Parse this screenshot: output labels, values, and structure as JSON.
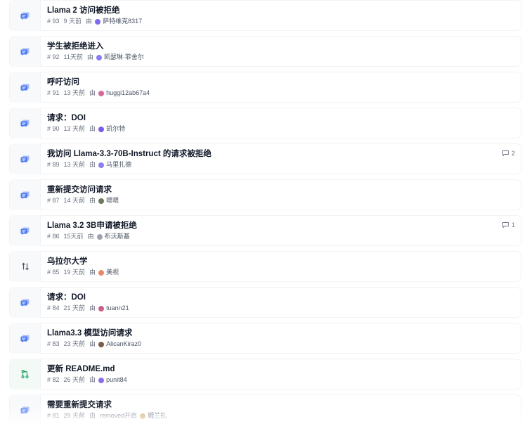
{
  "discussions": [
    {
      "title": "Llama 2 访问被拒绝",
      "number": "# 93",
      "age": "9 天前",
      "by": "由",
      "author": "萨特维克8317",
      "type": "discussion",
      "avatar_color": "#7c6cf0",
      "comments": null
    },
    {
      "title": "学生被拒绝进入",
      "number": "# 92",
      "age": "11天前",
      "by": "由",
      "author": "凯瑟琳·菲舍尔",
      "type": "discussion",
      "avatar_color": "#8b7cf6",
      "comments": null
    },
    {
      "title": "呼吁访问",
      "number": "# 91",
      "age": "13 天前",
      "by": "由",
      "author": "huggi12ab67a4",
      "type": "discussion",
      "avatar_color": "#d9679b",
      "comments": null
    },
    {
      "title": "请求：DOI",
      "number": "# 90",
      "age": "13 天前",
      "by": "由",
      "author": "凯尔特",
      "type": "discussion",
      "avatar_color": "#7a5af0",
      "comments": null
    },
    {
      "title": "我访问 Llama-3.3-70B-Instruct 的请求被拒绝",
      "number": "# 89",
      "age": "13 天前",
      "by": "由",
      "author": "马里扎德",
      "type": "discussion",
      "avatar_color": "#8b80f2",
      "comments": "2"
    },
    {
      "title": "重新提交访问请求",
      "number": "# 87",
      "age": "14 天前",
      "by": "由",
      "author": "嗯嗯",
      "type": "discussion",
      "avatar_color": "#6b7a5a",
      "comments": null
    },
    {
      "title": "Llama 3.2 3B申请被拒绝",
      "number": "# 86",
      "age": "15天前",
      "by": "由",
      "author": "布沃斯基",
      "type": "discussion",
      "avatar_color": "#9ca3af",
      "comments": "1"
    },
    {
      "title": "乌拉尔大学",
      "number": "# 85",
      "age": "19 天前",
      "by": "由",
      "author": "美视",
      "type": "other",
      "avatar_color": "#e88a6a",
      "comments": null
    },
    {
      "title": "请求：DOI",
      "number": "# 84",
      "age": "21 天前",
      "by": "由",
      "author": "tuann21",
      "type": "discussion",
      "avatar_color": "#c8608a",
      "comments": null
    },
    {
      "title": "Llama3.3 模型访问请求",
      "number": "# 83",
      "age": "23 天前",
      "by": "由",
      "author": "AlicanKiraz0",
      "type": "discussion",
      "avatar_color": "#7b5e4a",
      "comments": null
    },
    {
      "title": "更新 README.md",
      "number": "# 82",
      "age": "26 天前",
      "by": "由",
      "author": "punit84",
      "type": "pull-request",
      "avatar_color": "#8a6ee8",
      "comments": null
    },
    {
      "title": "需要重新提交请求",
      "number": "# 81",
      "age": "29 天前",
      "by": "由",
      "author": "姆兰扎",
      "type": "discussion",
      "avatar_color": "#c9a86a",
      "comments": null,
      "extra": "removed开启"
    }
  ],
  "colors": {
    "discussion_icon": "#4f7cf0",
    "pr_icon": "#22a36a",
    "other_icon": "#4b5563"
  }
}
